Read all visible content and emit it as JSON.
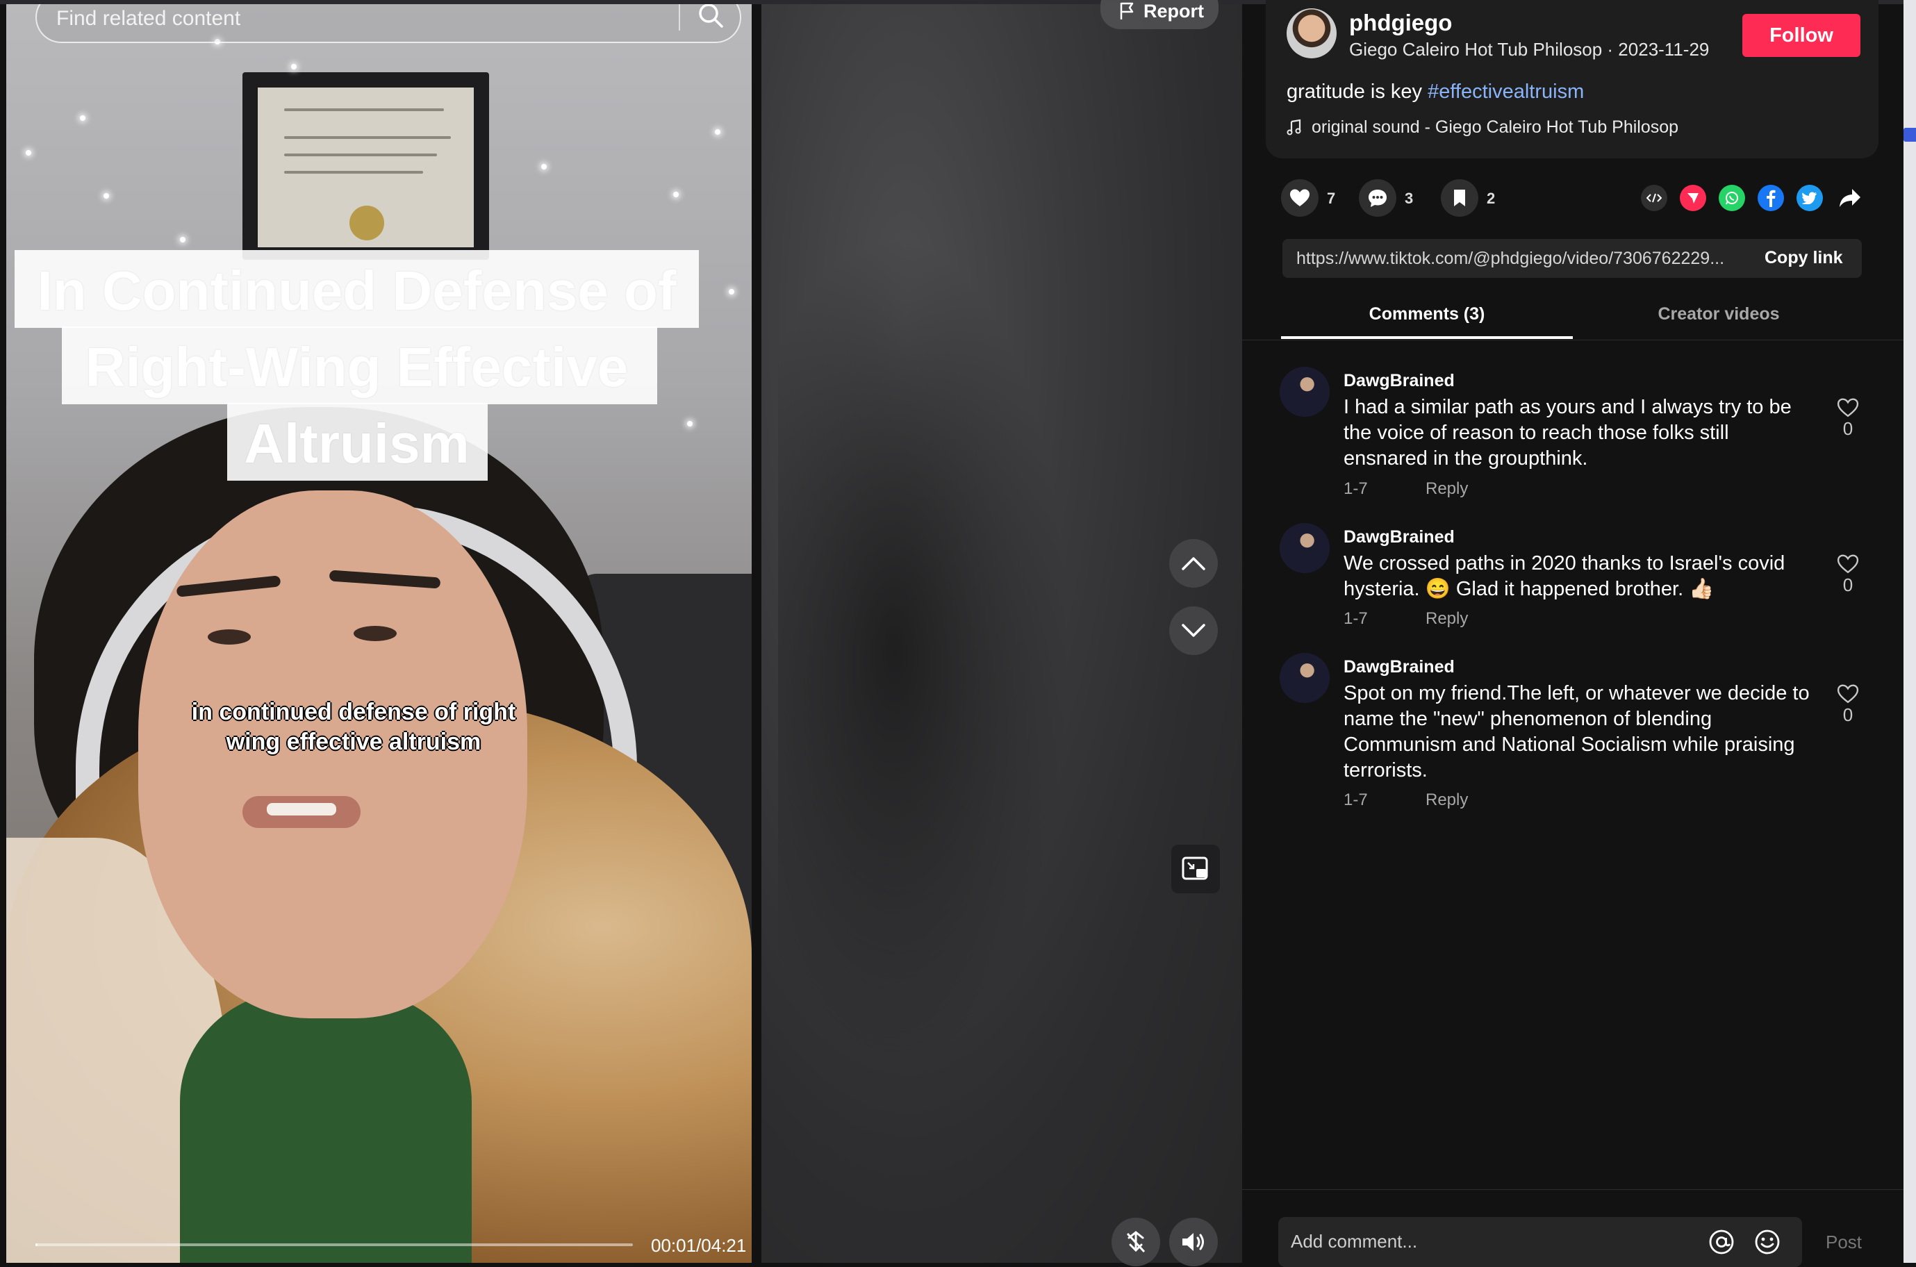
{
  "video": {
    "search_placeholder": "Find related content",
    "title_overlay": [
      "In Continued Defense of",
      "Right-Wing Effective",
      "Altruism"
    ],
    "caption_lines": [
      "in continued defense of right",
      "wing effective altruism"
    ],
    "timestamp": "00:01/04:21",
    "progress_fraction": 0.004
  },
  "player": {
    "report_label": "Report"
  },
  "author": {
    "username": "phdgiego",
    "subline": "Giego Caleiro Hot Tub Philosop · 2023-11-29",
    "follow_label": "Follow",
    "description_text": "gratitude is key ",
    "hashtag": "#effectivealtruism",
    "music": "original sound - Giego Caleiro Hot Tub Philosop"
  },
  "actions": {
    "likes": "7",
    "comments": "3",
    "saves": "2"
  },
  "share": {
    "link": "https://www.tiktok.com/@phdgiego/video/7306762229...",
    "copy_label": "Copy link",
    "colors": {
      "tiktok_red": "#fe2c55",
      "whatsapp": "#25d366",
      "facebook": "#1877f2",
      "twitter": "#1d9bf0"
    }
  },
  "tabs": [
    "Comments (3)",
    "Creator videos"
  ],
  "comments": [
    {
      "user": "DawgBrained",
      "lines": [
        "I had a similar path as yours and I always try to be",
        "the voice of reason to reach those folks still",
        "ensnared in the groupthink."
      ],
      "date": "1-7",
      "reply": "Reply",
      "likes": "0"
    },
    {
      "user": "DawgBrained",
      "lines": [
        "We crossed paths in 2020 thanks to Israel's covid",
        "hysteria. 😄 Glad it happened brother. 👍🏻"
      ],
      "date": "1-7",
      "reply": "Reply",
      "likes": "0"
    },
    {
      "user": "DawgBrained",
      "lines": [
        "Spot on my friend.The left, or whatever we decide to",
        "name the \"new\" phenomenon of blending",
        "Communism and National Socialism while praising",
        "terrorists."
      ],
      "date": "1-7",
      "reply": "Reply",
      "likes": "0"
    }
  ],
  "composer": {
    "placeholder": "Add comment...",
    "post_label": "Post"
  },
  "accent_color": "#fe2c55"
}
